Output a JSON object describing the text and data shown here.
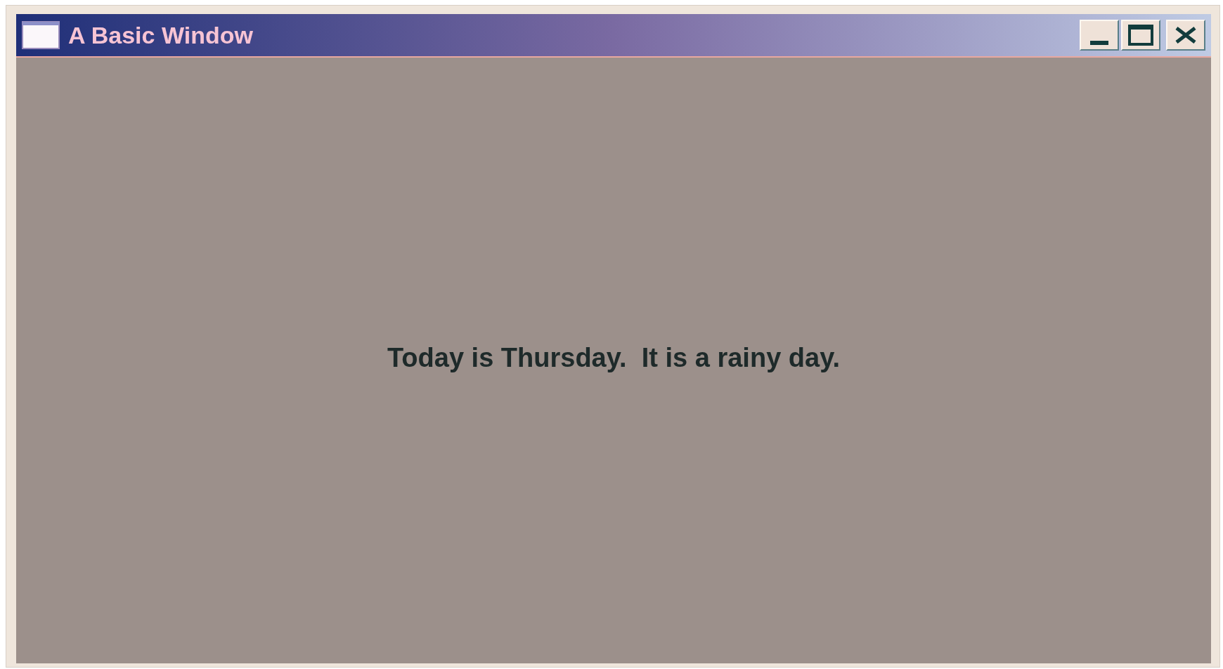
{
  "window": {
    "title": "A Basic Window"
  },
  "content": {
    "message": "Today is Thursday.  It is a rainy day."
  }
}
